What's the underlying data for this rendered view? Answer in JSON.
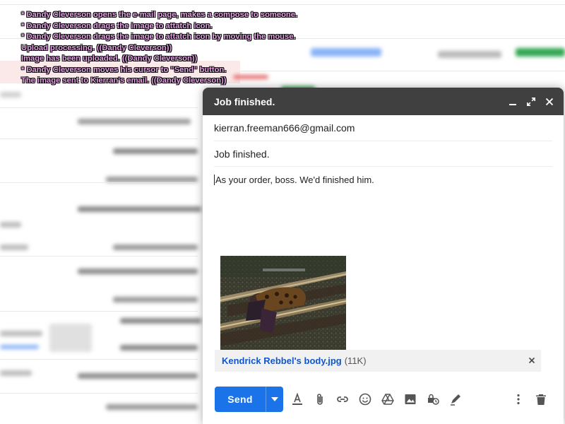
{
  "rp_log": [
    "* Dandy Cleverson opens the e-mail page, makes a compose to someone.",
    "* Dandy Cleverson drags the image to attatch icon.",
    "* Dandy Cleverson drags the image to attatch icon by moving the mouse.",
    "Upload processing. ((Dandy Cleverson))",
    "Image has been uploaded. ((Dandy Cleverson))",
    "* Dandy Cleverson moves his cursor to \"Send\" button.",
    "The image sent to Kierran's email. ((Dandy Cleverson))"
  ],
  "compose": {
    "title": "Job finished.",
    "to": "kierran.freeman666@gmail.com",
    "subject": "Job finished.",
    "body": "As your order, boss. We'd finished him.",
    "attachment": {
      "name": "Kendrick Rebbel's body.jpg",
      "size": "(11K)"
    },
    "send_label": "Send"
  },
  "colors": {
    "header_bg": "#404040",
    "send_blue": "#1a73e8",
    "attachment_link": "#1155cc",
    "rp_text": "#e6a3e6"
  },
  "icons": {
    "header": [
      "minimize-icon",
      "expand-icon",
      "close-icon"
    ],
    "toolbar": [
      "format-text-icon",
      "attach-file-icon",
      "insert-link-icon",
      "emoji-icon",
      "google-drive-icon",
      "insert-photo-icon",
      "confidential-mode-icon",
      "signature-icon"
    ],
    "toolbar_right": [
      "more-options-icon",
      "discard-draft-icon"
    ]
  }
}
